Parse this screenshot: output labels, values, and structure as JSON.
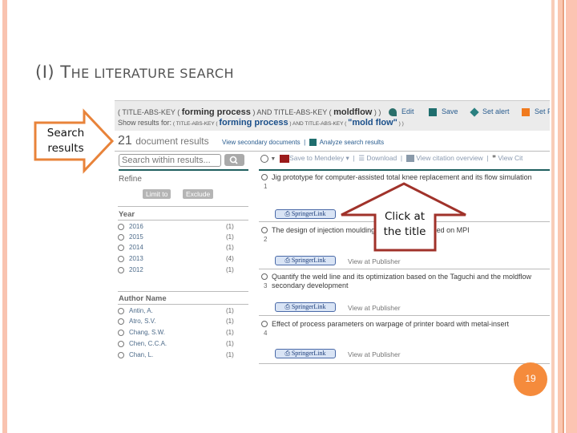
{
  "slide": {
    "title_prefix": "(I) T",
    "title_rest": "HE LITERATURE SEARCH",
    "page_number": "19",
    "colors": {
      "stripe": "#f9c3b0",
      "accent": "#f58b3c",
      "callout_orange": "#e8833a",
      "callout_red": "#a0322a"
    }
  },
  "callouts": {
    "search_results": {
      "line1": "Search",
      "line2": "results"
    },
    "click_title": {
      "line1": "Click at",
      "line2": "the title"
    }
  },
  "query": {
    "line1": {
      "p1": "( TITLE-ABS-KEY  ( ",
      "b1": "forming process",
      "p2": " )  AND  TITLE-ABS-KEY  ( ",
      "b2": "moldflow",
      "p3": " ) )"
    },
    "line2": {
      "label": "Show results for:",
      "p1": " ( TITLE-ABS-KEY  ( ",
      "b1": "forming  process",
      "p2": " )  AND  TITLE-ABS-KEY  ( ",
      "b2": "\"mold flow\"",
      "p3": " ) )"
    },
    "actions": {
      "edit": "Edit",
      "save": "Save",
      "set_alert": "Set alert",
      "set_feed": "Set F"
    }
  },
  "results_header": {
    "count": "21",
    "count_label": "document results",
    "view_secondary": "View secondary documents",
    "analyze": "Analyze search results"
  },
  "search_within": {
    "placeholder": "Search within results..."
  },
  "refine": {
    "label": "Refine",
    "limit_to": "Limit to",
    "exclude": "Exclude"
  },
  "facets": {
    "year": {
      "heading": "Year",
      "items": [
        {
          "label": "2016",
          "count": "(1)"
        },
        {
          "label": "2015",
          "count": "(1)"
        },
        {
          "label": "2014",
          "count": "(1)"
        },
        {
          "label": "2013",
          "count": "(4)"
        },
        {
          "label": "2012",
          "count": "(1)"
        }
      ]
    },
    "author": {
      "heading": "Author Name",
      "items": [
        {
          "label": "Antin, A.",
          "count": "(1)"
        },
        {
          "label": "Atro, S.V.",
          "count": "(1)"
        },
        {
          "label": "Chang, S.W.",
          "count": "(1)"
        },
        {
          "label": "Chen, C.C.A.",
          "count": "(1)"
        },
        {
          "label": "Chan, L.",
          "count": "(1)"
        }
      ]
    }
  },
  "toolbar": {
    "mendeley": "Save to Mendeley",
    "download": "Download",
    "citation_overview": "View citation overview",
    "view_cited": "View Cit"
  },
  "results": [
    {
      "num": "1",
      "title": "Jig prototype for computer-assisted total knee replacement and its flow simulation",
      "springer": "SpringerLink",
      "publisher": ""
    },
    {
      "num": "2",
      "title": "The design of injection moulding ... y apparatus based on MPI",
      "springer": "SpringerLink",
      "publisher": "View at Publisher"
    },
    {
      "num": "3",
      "title": "Quantify the weld line and its optimization based on the Taguchi and the moldflow secondary development",
      "springer": "SpringerLink",
      "publisher": "View at Publisher"
    },
    {
      "num": "4",
      "title": "Effect of process parameters on warpage of printer board with metal-insert",
      "springer": "SpringerLink",
      "publisher": "View at Publisher"
    }
  ]
}
